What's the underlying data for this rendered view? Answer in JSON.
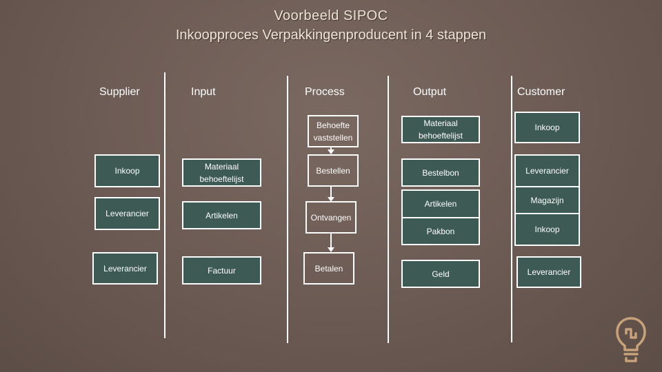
{
  "title": {
    "line1": "Voorbeeld SIPOC",
    "line2": "Inkoopproces Verpakkingenproducent in 4 stappen"
  },
  "columns": {
    "supplier": "Supplier",
    "input": "Input",
    "process": "Process",
    "output": "Output",
    "customer": "Customer"
  },
  "supplier": [
    "Inkoop",
    "Leverancier",
    "Leverancier"
  ],
  "input": [
    "Materiaal behoeftelijst",
    "Artikelen",
    "Factuur"
  ],
  "process": [
    "Behoefte vaststellen",
    "Bestellen",
    "Ontvangen",
    "Betalen"
  ],
  "output": [
    "Materiaal behoeftelijst",
    "Bestelbon",
    "Artikelen",
    "Pakbon",
    "Geld"
  ],
  "customer": [
    "Inkoop",
    "Leverancier",
    "Magazijn",
    "Inkoop",
    "Leverancier"
  ],
  "colors": {
    "box_fill": "#3d5a54",
    "border": "#ffffff",
    "background": "#6b5a53",
    "icon": "#c8a27a"
  },
  "icons": {
    "corner": "lightbulb-icon"
  }
}
